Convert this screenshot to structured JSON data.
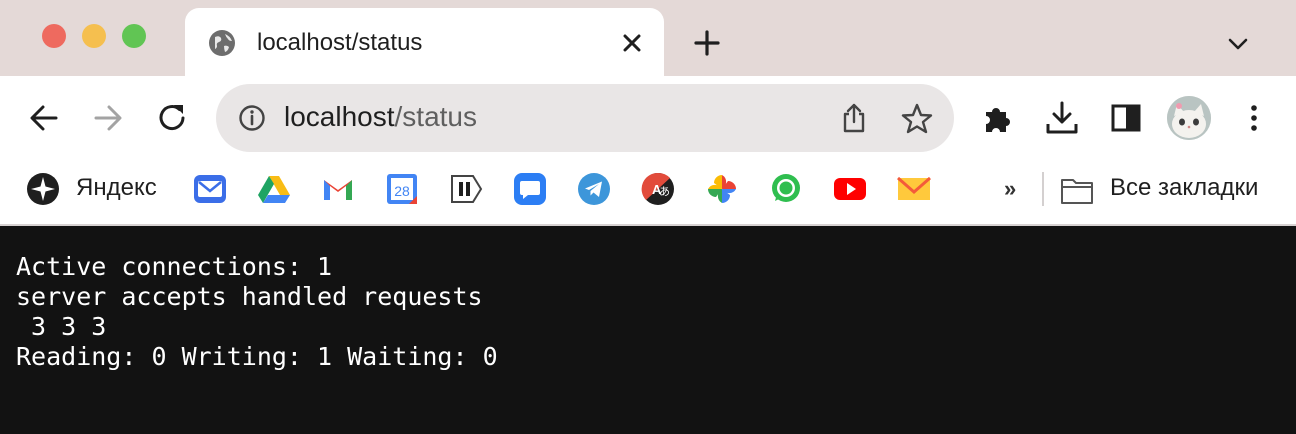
{
  "window": {
    "tab": {
      "title": "localhost/status",
      "icon": "globe-icon"
    }
  },
  "toolbar": {
    "url_host": "localhost",
    "url_path": "/status"
  },
  "bookmarks": {
    "items": [
      {
        "label": "Яндекс",
        "icon": "yandex-icon"
      },
      {
        "label": "",
        "icon": "yandex-mail-icon"
      },
      {
        "label": "",
        "icon": "google-drive-icon"
      },
      {
        "label": "",
        "icon": "gmail-icon"
      },
      {
        "label": "28",
        "icon": "google-calendar-icon"
      },
      {
        "label": "",
        "icon": "pause-tag-icon"
      },
      {
        "label": "",
        "icon": "chat-bubble-icon"
      },
      {
        "label": "",
        "icon": "telegram-icon"
      },
      {
        "label": "",
        "icon": "translate-icon"
      },
      {
        "label": "",
        "icon": "google-photos-icon"
      },
      {
        "label": "",
        "icon": "whatsapp-icon"
      },
      {
        "label": "",
        "icon": "youtube-icon"
      },
      {
        "label": "",
        "icon": "mail-envelope-icon"
      }
    ],
    "overflow": "»",
    "all_bookmarks": "Все закладки"
  },
  "page": {
    "line1": "Active connections: 1",
    "line2": "server accepts handled requests",
    "line3": " 3 3 3",
    "line4": "Reading: 0 Writing: 1 Waiting: 0"
  },
  "colors": {
    "titlebar": "#e4d9d7",
    "content_bg": "#121212",
    "traffic_red": "#ee6a5f",
    "traffic_yellow": "#f5bf4f",
    "traffic_green": "#61c554"
  }
}
